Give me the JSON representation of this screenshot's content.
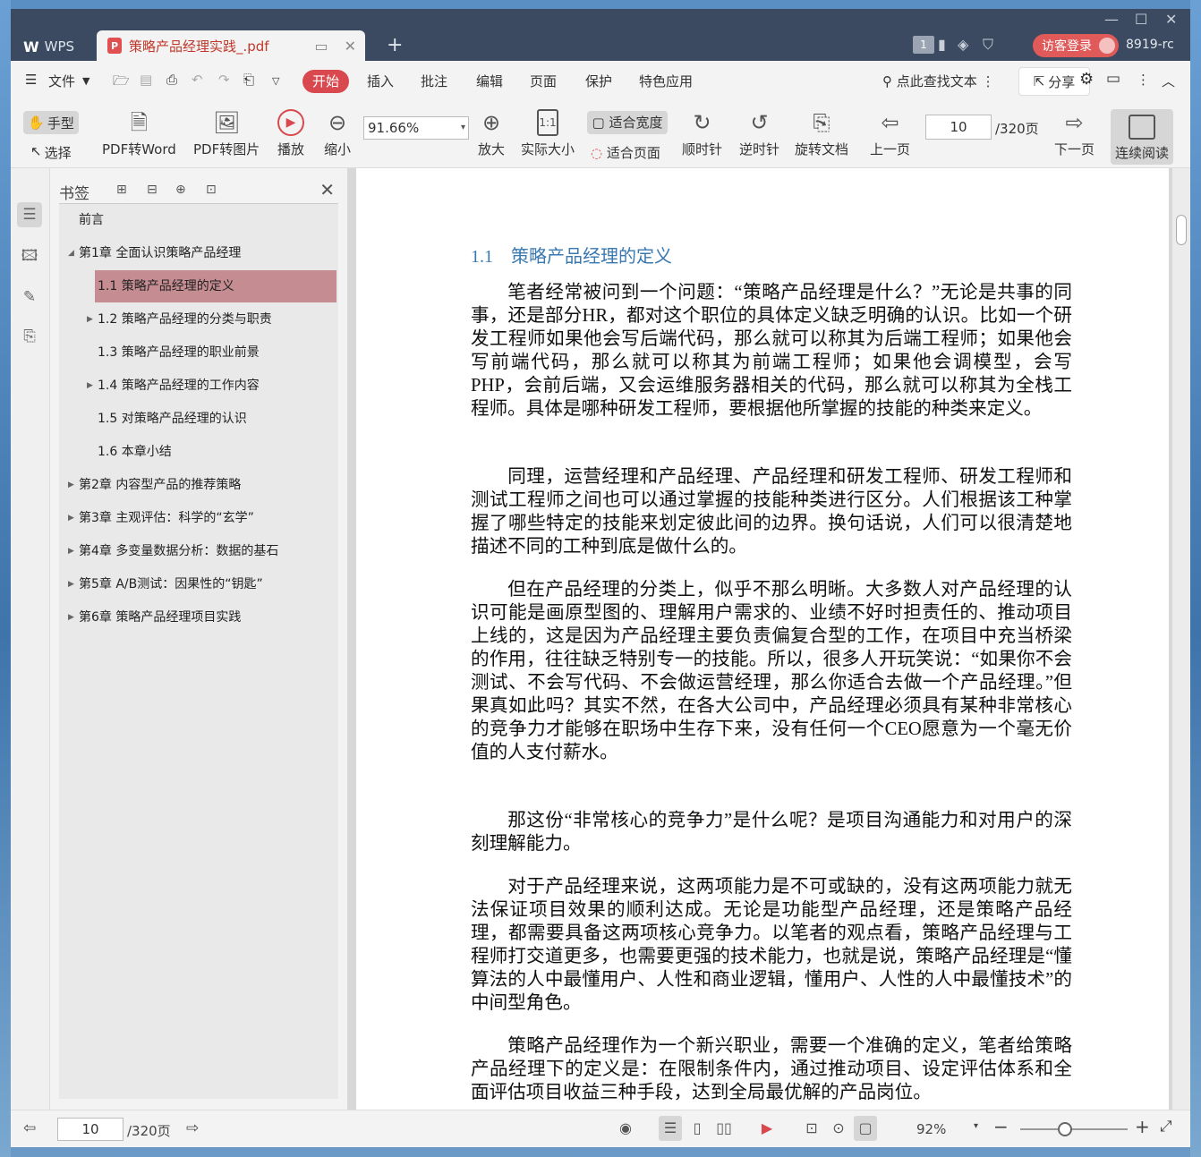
{
  "titlebar": {
    "app_tab": "WPS",
    "app_logo": "W",
    "doc_tab": "策略产品经理实践_.pdf",
    "page_badge": "1",
    "login": "访客登录",
    "user": "8919-rc"
  },
  "menu": {
    "file": "文件",
    "items": [
      "开始",
      "插入",
      "批注",
      "编辑",
      "页面",
      "保护",
      "特色应用"
    ],
    "search": "点此查找文本",
    "share": "分享"
  },
  "toolbar": {
    "hand": "手型",
    "select": "选择",
    "pdf_to_word": "PDF转Word",
    "pdf_to_image": "PDF转图片",
    "play": "播放",
    "zoom_out": "缩小",
    "zoom_value": "91.66%",
    "zoom_in": "放大",
    "actual_size": "实际大小",
    "fit_width": "适合宽度",
    "fit_page": "适合页面",
    "clockwise": "顺时针",
    "counterclockwise": "逆时针",
    "rotate_doc": "旋转文档",
    "prev_page": "上一页",
    "current_page": "10",
    "total_pages": "/320页",
    "next_page": "下一页",
    "continuous": "连续阅读"
  },
  "bookmarks": {
    "title": "书签",
    "items": [
      {
        "label": "前言",
        "level": 0,
        "arrow": ""
      },
      {
        "label": "第1章 全面认识策略产品经理",
        "level": 0,
        "arrow": "◢"
      },
      {
        "label": "1.1 策略产品经理的定义",
        "level": 1,
        "arrow": "",
        "selected": true
      },
      {
        "label": "1.2 策略产品经理的分类与职责",
        "level": 1,
        "arrow": "▶"
      },
      {
        "label": "1.3 策略产品经理的职业前景",
        "level": 1,
        "arrow": ""
      },
      {
        "label": "1.4 策略产品经理的工作内容",
        "level": 1,
        "arrow": "▶"
      },
      {
        "label": "1.5 对策略产品经理的认识",
        "level": 1,
        "arrow": ""
      },
      {
        "label": "1.6 本章小结",
        "level": 1,
        "arrow": ""
      },
      {
        "label": "第2章 内容型产品的推荐策略",
        "level": 0,
        "arrow": "▶"
      },
      {
        "label": "第3章 主观评估：科学的“玄学”",
        "level": 0,
        "arrow": "▶"
      },
      {
        "label": "第4章 多变量数据分析：数据的基石",
        "level": 0,
        "arrow": "▶"
      },
      {
        "label": "第5章 A/B测试：因果性的“钥匙”",
        "level": 0,
        "arrow": "▶"
      },
      {
        "label": "第6章 策略产品经理项目实践",
        "level": 0,
        "arrow": "▶"
      }
    ]
  },
  "document": {
    "heading": "1.1　策略产品经理的定义",
    "paragraphs": [
      "笔者经常被问到一个问题：“策略产品经理是什么？”无论是共事的同事，还是部分HR，都对这个职位的具体定义缺乏明确的认识。比如一个研发工程师如果他会写后端代码，那么就可以称其为后端工程师；如果他会写前端代码，那么就可以称其为前端工程师；如果他会调模型，会写PHP，会前后端，又会运维服务器相关的代码，那么就可以称其为全栈工程师。具体是哪种研发工程师，要根据他所掌握的技能的种类来定义。",
      "同理，运营经理和产品经理、产品经理和研发工程师、研发工程师和测试工程师之间也可以通过掌握的技能种类进行区分。人们根据该工种掌握了哪些特定的技能来划定彼此间的边界。换句话说，人们可以很清楚地描述不同的工种到底是做什么的。",
      "但在产品经理的分类上，似乎不那么明晰。大多数人对产品经理的认识可能是画原型图的、理解用户需求的、业绩不好时担责任的、推动项目上线的，这是因为产品经理主要负责偏复合型的工作，在项目中充当桥梁的作用，往往缺乏特别专一的技能。所以，很多人开玩笑说：“如果你不会测试、不会写代码、不会做运营经理，那么你适合去做一个产品经理。”但果真如此吗？其实不然，在各大公司中，产品经理必须具有某种非常核心的竞争力才能够在职场中生存下来，没有任何一个CEO愿意为一个毫无价值的人支付薪水。",
      "那这份“非常核心的竞争力”是什么呢？是项目沟通能力和对用户的深刻理解能力。",
      "对于产品经理来说，这两项能力是不可或缺的，没有这两项能力就无法保证项目效果的顺利达成。无论是功能型产品经理，还是策略产品经理，都需要具备这两项核心竞争力。以笔者的观点看，策略产品经理与工程师打交道更多，也需要更强的技术能力，也就是说，策略产品经理是“懂算法的人中最懂用户、人性和商业逻辑，懂用户、人性的人中最懂技术”的中间型角色。",
      "策略产品经理作为一个新兴职业，需要一个准确的定义，笔者给策略产品经理下的定义是：在限制条件内，通过推动项目、设定评估体系和全面评估项目收益三种手段，达到全局最优解的产品岗位。"
    ]
  },
  "statusbar": {
    "current_page": "10",
    "total_pages": "/320页",
    "zoom": "92%"
  },
  "colors": {
    "titlebar": "#3b4a60",
    "accent": "#d9484e",
    "selected_bookmark": "#c58c92",
    "heading": "#3a78b0"
  }
}
